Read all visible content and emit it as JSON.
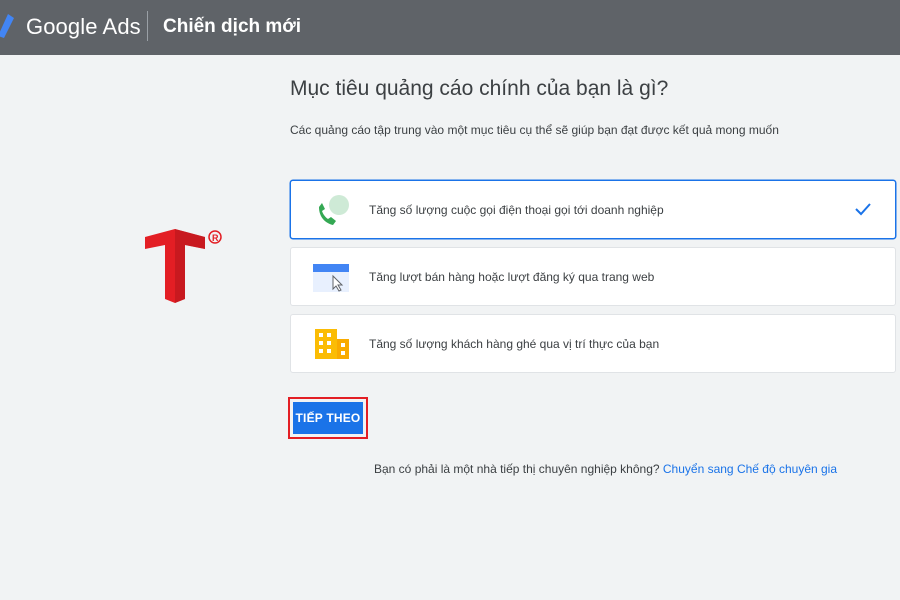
{
  "header": {
    "brand": "Google Ads",
    "title": "Chiến dịch mới"
  },
  "main": {
    "heading": "Mục tiêu quảng cáo chính của bạn là gì?",
    "subheading": "Các quảng cáo tập trung vào một mục tiêu cụ thể sẽ giúp bạn đạt được kết quả mong muốn",
    "options": [
      {
        "label": "Tăng số lượng cuộc gọi điện thoại gọi tới doanh nghiệp",
        "icon": "phone-call-icon",
        "selected": true
      },
      {
        "label": "Tăng lượt bán hàng hoặc lượt đăng ký qua trang web",
        "icon": "browser-cursor-icon",
        "selected": false
      },
      {
        "label": "Tăng số lượng khách hàng ghé qua vị trí thực của bạn",
        "icon": "building-icon",
        "selected": false
      }
    ],
    "next_label": "TIẾP THEO",
    "footer_question": "Bạn có phải là một nhà tiếp thị chuyên nghiệp không?",
    "footer_link": "Chuyển sang Chế độ chuyên gia"
  },
  "colors": {
    "header_bg": "#5f6368",
    "accent": "#1a73e8",
    "highlight_border": "#e31e24",
    "watermark": "#e31e24"
  }
}
